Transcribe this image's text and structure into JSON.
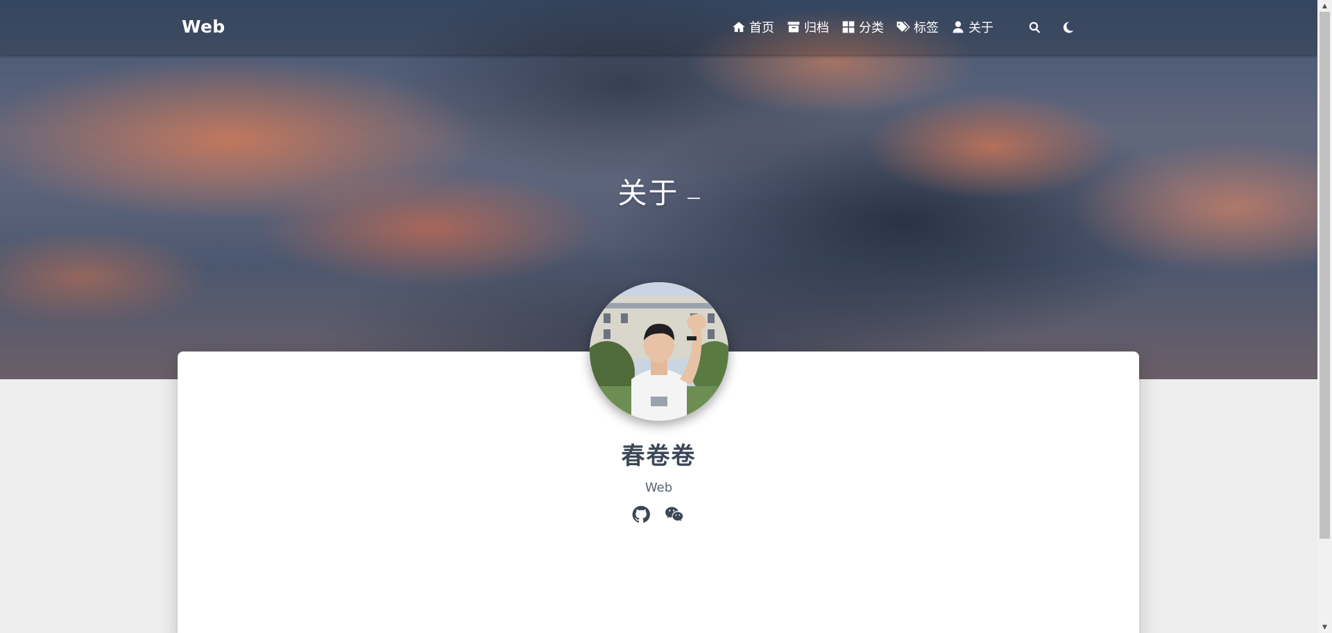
{
  "navbar": {
    "brand": "Web",
    "items": [
      {
        "label": "首页",
        "icon": "home-icon"
      },
      {
        "label": "归档",
        "icon": "archive-icon"
      },
      {
        "label": "分类",
        "icon": "th-large-icon"
      },
      {
        "label": "标签",
        "icon": "tags-icon"
      },
      {
        "label": "关于",
        "icon": "user-icon"
      }
    ],
    "search_icon": "search-icon",
    "theme_toggle_icon": "moon-icon"
  },
  "hero": {
    "title": "关于"
  },
  "profile": {
    "name": "春卷卷",
    "subtitle": "Web",
    "social": [
      {
        "icon": "github-icon"
      },
      {
        "icon": "wechat-icon"
      }
    ]
  },
  "colors": {
    "page_background": "#eeeeee",
    "card_background": "#ffffff",
    "profile_text": "#3c4656",
    "navbar_text": "#ffffff"
  }
}
